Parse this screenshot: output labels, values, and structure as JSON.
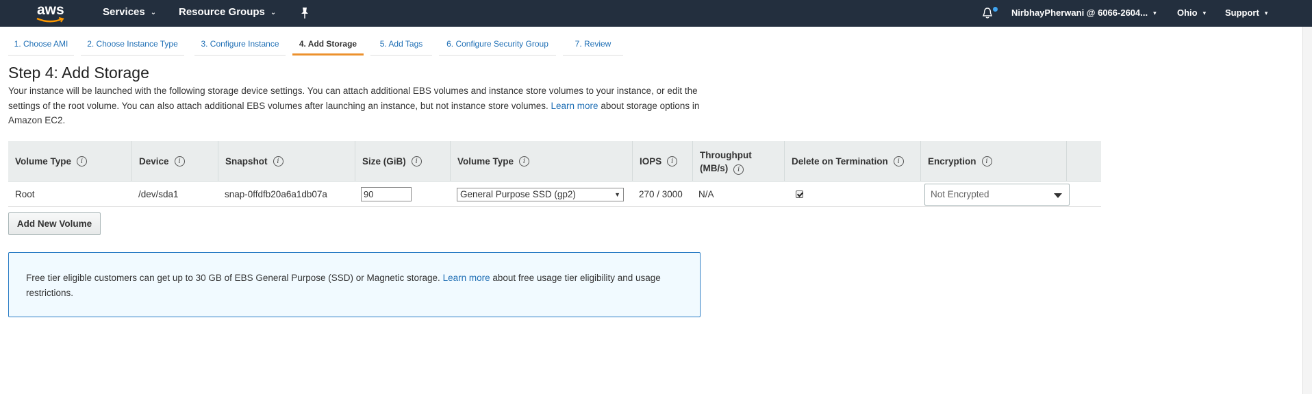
{
  "topnav": {
    "logo_text": "aws",
    "services": "Services",
    "resource_groups": "Resource Groups",
    "account": "NirbhayPherwani @ 6066-2604...",
    "region": "Ohio",
    "support": "Support"
  },
  "tabs": [
    {
      "label": "1. Choose AMI"
    },
    {
      "label": "2. Choose Instance Type"
    },
    {
      "label": "3. Configure Instance"
    },
    {
      "label": "4. Add Storage"
    },
    {
      "label": "5. Add Tags"
    },
    {
      "label": "6. Configure Security Group"
    },
    {
      "label": "7. Review"
    }
  ],
  "page": {
    "title": "Step 4: Add Storage",
    "desc_1": "Your instance will be launched with the following storage device settings. You can attach additional EBS volumes and instance store volumes to your instance, or edit the settings of the root volume. You can also attach additional EBS volumes after launching an instance, but not instance store volumes.",
    "desc_link": "Learn more",
    "desc_2": "about storage options in Amazon EC2."
  },
  "table": {
    "headers": {
      "volume_type": "Volume Type",
      "device": "Device",
      "snapshot": "Snapshot",
      "size": "Size (GiB)",
      "volume_type2": "Volume Type",
      "iops": "IOPS",
      "throughput_1": "Throughput",
      "throughput_2": "(MB/s)",
      "delete": "Delete on Termination",
      "encryption": "Encryption"
    },
    "row": {
      "volume_type": "Root",
      "device": "/dev/sda1",
      "snapshot": "snap-0ffdfb20a6a1db07a",
      "size": "90",
      "volume_type_select": "General Purpose SSD (gp2)",
      "iops": "270 / 3000",
      "throughput": "N/A",
      "encryption": "Not Encrypted"
    }
  },
  "add_volume": "Add New Volume",
  "info": {
    "text_1": "Free tier eligible customers can get up to 30 GB of EBS General Purpose (SSD) or Magnetic storage.",
    "link": "Learn more",
    "text_2": "about free usage tier eligibility and usage restrictions."
  },
  "colors": {
    "nav_bg": "#232f3e",
    "active_tab": "#ec912d",
    "link": "#1f6fb5",
    "info_border": "#2a7dc5"
  }
}
